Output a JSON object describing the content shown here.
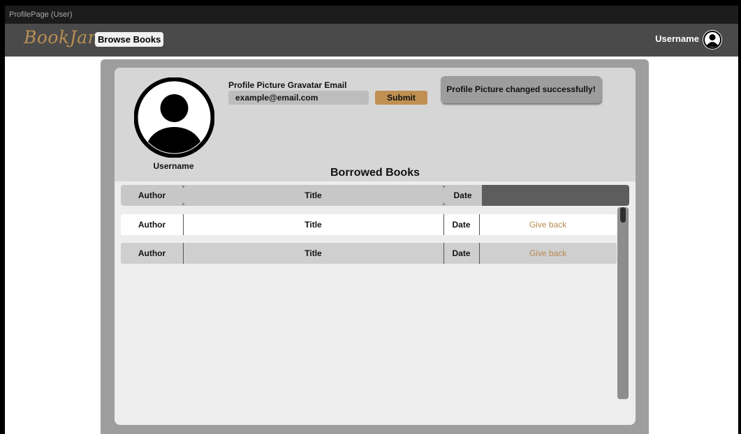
{
  "window": {
    "title": "ProfilePage (User)"
  },
  "navbar": {
    "brand": "BookJam",
    "browse_label": "Browse Books",
    "username": "Username",
    "avatar_icon": "user-circle-icon"
  },
  "profile": {
    "avatar_icon": "user-circle-icon",
    "username": "Username",
    "email_label": "Profile Picture Gravatar Email",
    "email_value": "example@email.com",
    "submit_label": "Submit",
    "toast": "Profile Picture changed successfully!"
  },
  "borrowed": {
    "title": "Borrowed Books",
    "headers": {
      "author": "Author",
      "title": "Title",
      "date": "Date"
    },
    "rows": [
      {
        "author": "Author",
        "title": "Title",
        "date": "Date",
        "action": "Give back"
      },
      {
        "author": "Author",
        "title": "Title",
        "date": "Date",
        "action": "Give back"
      }
    ]
  },
  "colors": {
    "accent": "#c09052",
    "action_text": "#b88a4f",
    "navbar": "#4a4a4a",
    "panel": "#9e9e9e"
  }
}
